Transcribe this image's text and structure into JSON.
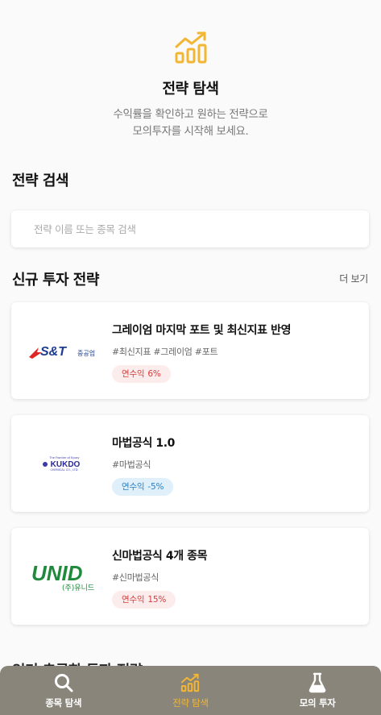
{
  "colors": {
    "accent": "#F2B632",
    "positive": "#D23D3D",
    "negative": "#2C7FC4",
    "nav_bg": "#8A857B"
  },
  "hero": {
    "icon": "chart-growth-icon",
    "title": "전략 탐색",
    "subtitle_line1": "수익률을 확인하고 원하는 전략으로",
    "subtitle_line2": "모의투자를 시작해 보세요."
  },
  "search": {
    "title": "전략 검색",
    "placeholder": "전략 이름 또는 종목 검색",
    "value": ""
  },
  "new_strategies": {
    "title": "신규 투자 전략",
    "more_label": "더 보기",
    "items": [
      {
        "logo_text": "S&T중공업",
        "logo_main": "S&T",
        "logo_sub": "중공업",
        "name": "그레이엄 마지막 포트 및 최신지표 반영",
        "tags": "#최신지표 #그레이엄 #포트",
        "return_label": "연수익",
        "return_value": "6%",
        "return_num": 6
      },
      {
        "logo_text": "KUKDO",
        "logo_main": "KUKDO",
        "logo_top": "The Frontier of Epoxy",
        "logo_bottom": "CHEMICAL CO., LTD.",
        "name": "마법공식 1.0",
        "tags": "#마법공식",
        "return_label": "연수익",
        "return_value": "-5%",
        "return_num": -5
      },
      {
        "logo_text": "UNID (주)유니드",
        "logo_main": "UNID",
        "logo_sub": "(주)유니드",
        "name": "신마법공식 4개 종목",
        "tags": "#신마법공식",
        "return_label": "연수익",
        "return_value": "15%",
        "return_num": 15
      }
    ]
  },
  "popular": {
    "title": "인기 추공한 투자 전략"
  },
  "nav": [
    {
      "label": "종목 탐색",
      "icon": "search-icon",
      "active": false
    },
    {
      "label": "전략 탐색",
      "icon": "chart-growth-icon",
      "active": true
    },
    {
      "label": "모의 투자",
      "icon": "flask-icon",
      "active": false
    }
  ]
}
